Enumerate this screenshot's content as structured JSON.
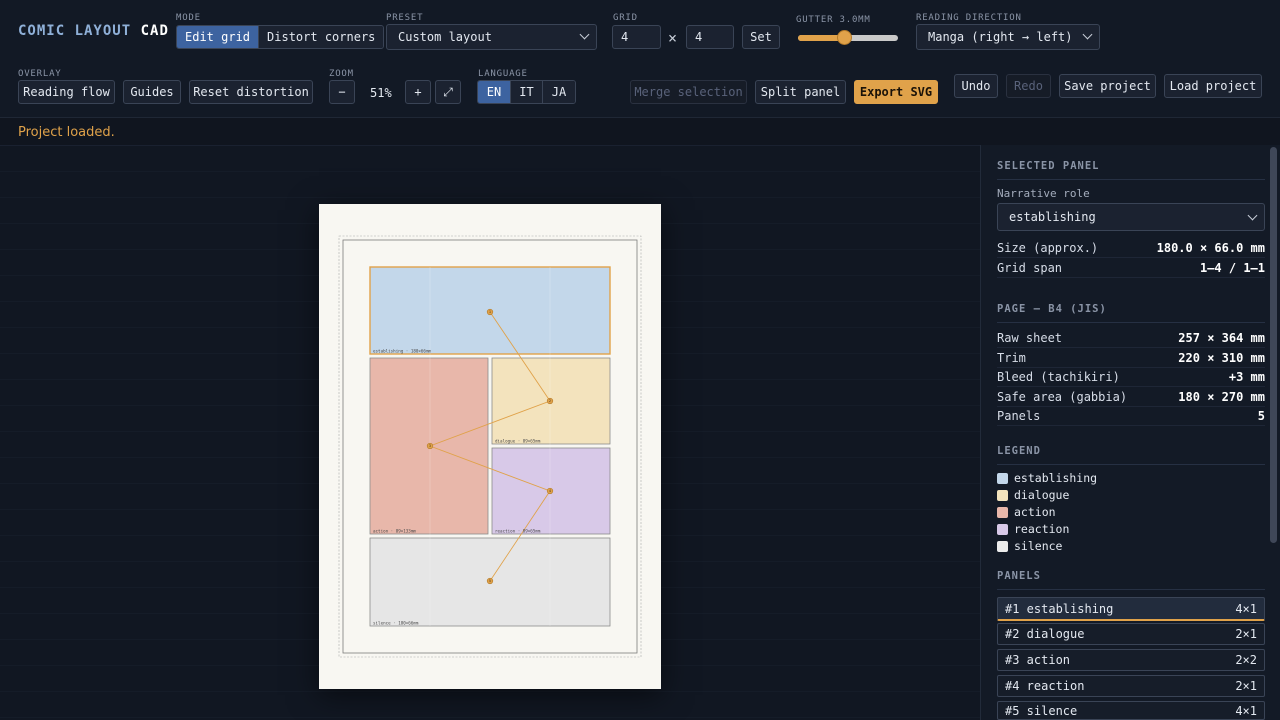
{
  "app": {
    "title_a": "COMIC LAYOUT",
    "title_b": "CAD"
  },
  "toolbar": {
    "mode_label": "MODE",
    "mode_options": [
      "Edit grid",
      "Distort corners"
    ],
    "preset_label": "PRESET",
    "preset_value": "Custom layout",
    "grid_label": "GRID",
    "grid_cols": "4",
    "grid_times": "×",
    "grid_rows": "4",
    "grid_set": "Set",
    "gutter_label": "GUTTER 3.0MM",
    "gutter_value": 0.18,
    "reading_label": "READING DIRECTION",
    "reading_value": "Manga (right → left)",
    "overlay_label": "OVERLAY",
    "reading_flow": "Reading flow",
    "guides": "Guides",
    "reset_distortion": "Reset distortion",
    "zoom_label": "ZOOM",
    "zoom_minus": "−",
    "zoom_value": "51%",
    "zoom_plus": "+",
    "zoom_fit": "⤢",
    "language_label": "LANGUAGE",
    "languages": [
      "EN",
      "IT",
      "JA"
    ],
    "merge_selection": "Merge selection",
    "split_panel": "Split panel",
    "export_svg": "Export SVG",
    "undo": "Undo",
    "redo": "Redo",
    "save_project": "Save project",
    "load_project": "Load project"
  },
  "status": "Project loaded.",
  "panels": [
    {
      "num": "1",
      "role": "establishing",
      "caption": "establishing · 180×66mm",
      "color": "#c3d7ea"
    },
    {
      "num": "2",
      "role": "dialogue",
      "caption": "dialogue · 89×65mm",
      "color": "#f3e3bd"
    },
    {
      "num": "3",
      "role": "action",
      "caption": "action · 89×133mm",
      "color": "#e8b7aa"
    },
    {
      "num": "4",
      "role": "reaction",
      "caption": "reaction · 89×65mm",
      "color": "#d8c9e8"
    },
    {
      "num": "5",
      "role": "silence",
      "caption": "silence · 180×66mm",
      "color": "#e6e6e6"
    }
  ],
  "sidebar": {
    "selected_title": "SELECTED PANEL",
    "narrative_label": "Narrative role",
    "narrative_value": "establishing",
    "size_k": "Size (approx.)",
    "size_v": "180.0 × 66.0 mm",
    "span_k": "Grid span",
    "span_v": "1–4 / 1–1",
    "page_title": "PAGE — B4 (JIS)",
    "raw_k": "Raw sheet",
    "raw_v": "257 × 364 mm",
    "trim_k": "Trim",
    "trim_v": "220 × 310 mm",
    "bleed_k": "Bleed (tachikiri)",
    "bleed_v": "+3 mm",
    "safe_k": "Safe area (gabbia)",
    "safe_v": "180 × 270 mm",
    "panels_k": "Panels",
    "panels_v": "5",
    "legend_title": "LEGEND",
    "legend": [
      {
        "name": "establishing",
        "color": "#c3d7ea"
      },
      {
        "name": "dialogue",
        "color": "#f3e3bd"
      },
      {
        "name": "action",
        "color": "#e8b7aa"
      },
      {
        "name": "reaction",
        "color": "#d8c9e8"
      },
      {
        "name": "silence",
        "color": "#ececec"
      }
    ],
    "panels_title": "PANELS",
    "panel_list": [
      {
        "label": "#1 establishing",
        "span": "4×1"
      },
      {
        "label": "#2 dialogue",
        "span": "2×1"
      },
      {
        "label": "#3 action",
        "span": "2×2"
      },
      {
        "label": "#4 reaction",
        "span": "2×1"
      },
      {
        "label": "#5 silence",
        "span": "4×1"
      }
    ]
  },
  "colors": {
    "accent": "#e0a24a",
    "active": "#3d63a0",
    "background": "#10151f"
  }
}
